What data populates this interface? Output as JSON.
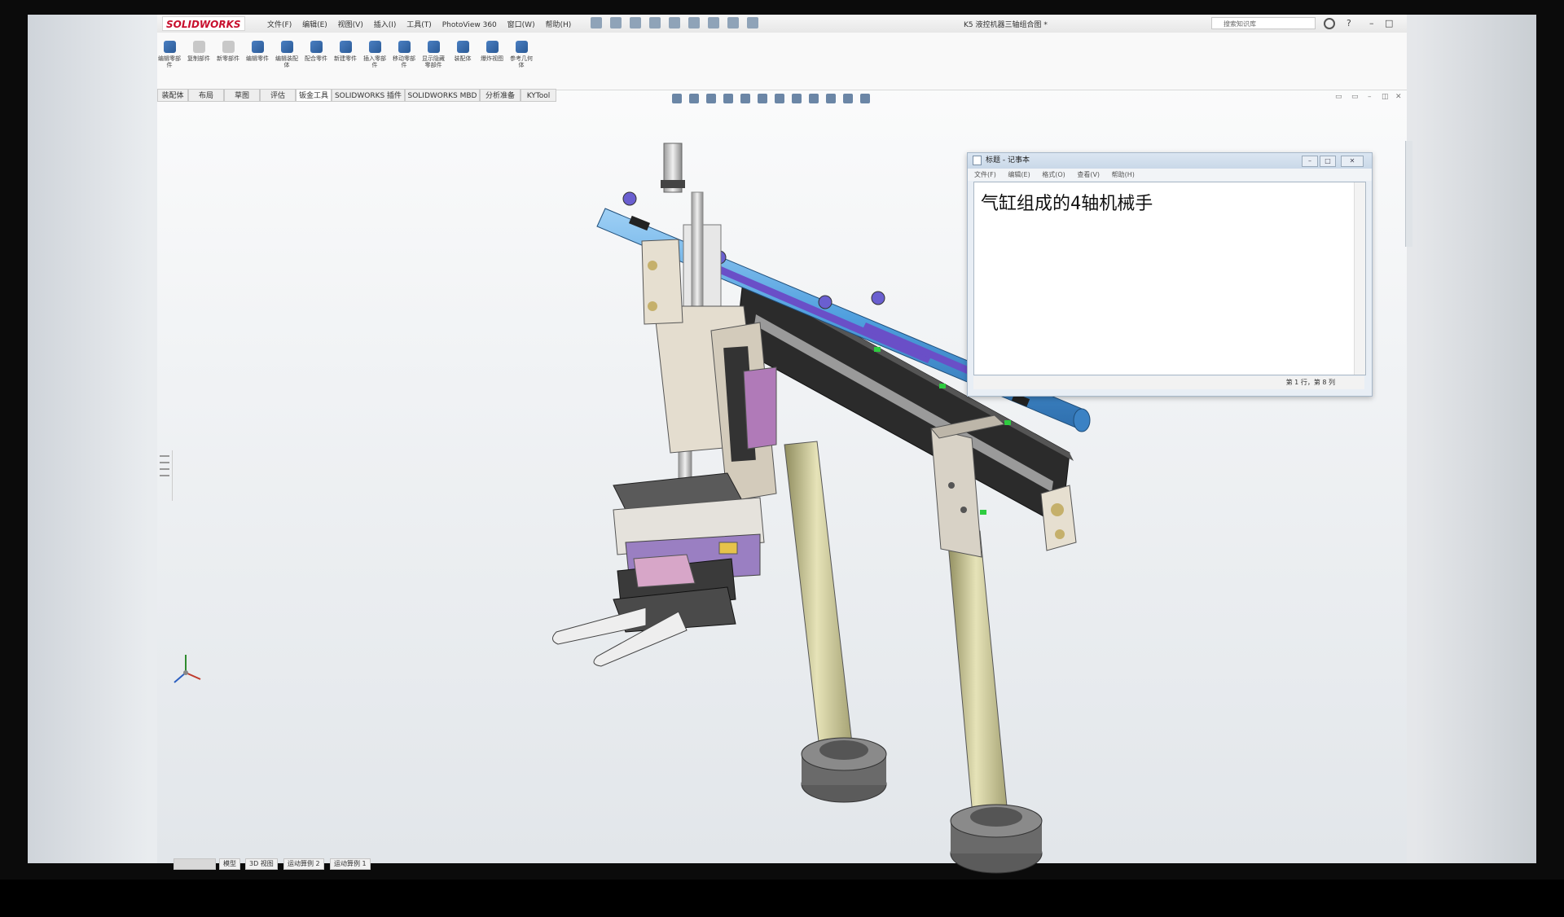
{
  "app": {
    "logo": "SOLIDWORKS",
    "menus": [
      "文件(F)",
      "编辑(E)",
      "视图(V)",
      "插入(I)",
      "工具(T)",
      "PhotoView 360",
      "窗口(W)",
      "帮助(H)"
    ],
    "document_title": "K5 液控机器三轴组合图 *",
    "search_placeholder": "搜索知识库",
    "window_controls": [
      "?",
      "–",
      "□"
    ]
  },
  "ribbon": {
    "buttons": [
      {
        "label": "编辑零部件",
        "enabled": true
      },
      {
        "label": "复制部件",
        "enabled": false
      },
      {
        "label": "新零部件",
        "enabled": false
      },
      {
        "label": "编辑零件",
        "enabled": true
      },
      {
        "label": "编辑装配体",
        "enabled": true
      },
      {
        "label": "配合零件",
        "enabled": true
      },
      {
        "label": "新建零件",
        "enabled": true
      },
      {
        "label": "插入零部件",
        "enabled": true
      },
      {
        "label": "移动零部件",
        "enabled": true
      },
      {
        "label": "显示隐藏零部件",
        "enabled": true
      },
      {
        "label": "装配体",
        "enabled": true
      },
      {
        "label": "爆炸视图",
        "enabled": true
      },
      {
        "label": "参考几何体",
        "enabled": true
      }
    ]
  },
  "tabs": [
    "装配体",
    "布局",
    "草图",
    "评估",
    "钣金工具",
    "SOLIDWORKS 插件",
    "SOLIDWORKS MBD",
    "分析准备",
    "KYTool"
  ],
  "active_tab": "钣金工具",
  "bottom_tabs": [
    "模型",
    "3D 视图",
    "运动算例 2",
    "运动算例 1"
  ],
  "notepad": {
    "title": "标题 - 记事本",
    "menu": [
      "文件(F)",
      "编辑(E)",
      "格式(O)",
      "查看(V)",
      "帮助(H)"
    ],
    "text": "气缸组成的4轴机械手",
    "status": "第 1 行，第 8 列",
    "buttons": [
      "–",
      "□",
      "✕"
    ]
  },
  "colors": {
    "cylinder_blue": "#5aa9e6",
    "rod_purple": "#6a4fc7",
    "column_olive": "#c9c79a",
    "frame_dark": "#2a2a2a",
    "accent_green": "#2ecc40",
    "bracket_cream": "#e4ddcf"
  },
  "icons": {
    "axis_triad": "xyz-axis-icon",
    "search": "search-icon"
  }
}
